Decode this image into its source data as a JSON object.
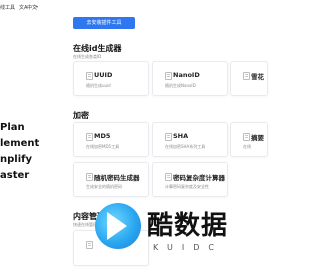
{
  "topbar": {
    "tool_label": "线工具",
    "language_label": "中文"
  },
  "left_panel": {
    "lines": [
      "Plan",
      "lement",
      "nplify",
      "aster"
    ]
  },
  "cta_label": "去安装插件工具",
  "sections": [
    {
      "title": "在线id生成器",
      "subtitle": "在线生成各类ID",
      "cards": [
        {
          "title": "UUID",
          "desc": "随机生成uuid"
        },
        {
          "title": "NanoID",
          "desc": "随机生成NanoID"
        },
        {
          "title": "雪花",
          "desc": ""
        }
      ]
    },
    {
      "title": "加密",
      "subtitle": "",
      "cards": [
        {
          "title": "MD5",
          "desc": "在线加密MD5工具"
        },
        {
          "title": "SHA",
          "desc": "在线加密SHA系列工具"
        },
        {
          "title": "摘要",
          "desc": "在线"
        },
        {
          "title": "随机密码生成器",
          "desc": "生成安全的随机密码"
        },
        {
          "title": "密码复杂度计算器",
          "desc": "计算密码复杂度及安全性"
        }
      ]
    },
    {
      "title": "内容管理",
      "subtitle": "快速在线管理",
      "cards": [
        {
          "title": "",
          "desc": ""
        }
      ]
    }
  ],
  "watermark": {
    "text": "酷数据",
    "sub": "KUIDC"
  },
  "colors": {
    "accent": "#2f77ef",
    "logo": "#2aa7f0"
  }
}
